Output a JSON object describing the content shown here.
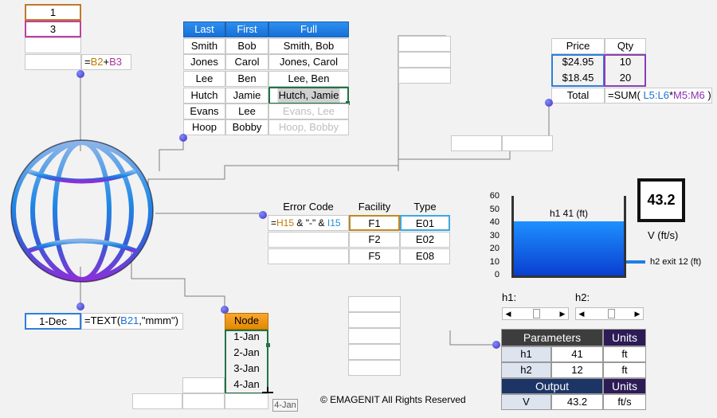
{
  "topleft": {
    "b2": "1",
    "b3": "3",
    "formula_prefix": "=",
    "formula_ref1": "B2",
    "formula_op": "+",
    "formula_ref2": "B3"
  },
  "names": {
    "headers": [
      "Last",
      "First",
      "Full"
    ],
    "rows": [
      [
        "Smith",
        "Bob",
        "Smith, Bob"
      ],
      [
        "Jones",
        "Carol",
        "Jones, Carol"
      ],
      [
        "Lee",
        "Ben",
        "Lee, Ben"
      ],
      [
        "Hutch",
        "Jamie",
        "Hutch, Jamie"
      ],
      [
        "Evans",
        "Lee",
        "Evans, Lee"
      ],
      [
        "Hoop",
        "Bobby",
        "Hoop, Bobby"
      ]
    ]
  },
  "prices": {
    "headers": [
      "Price",
      "Qty"
    ],
    "rows": [
      [
        "$24.95",
        "10"
      ],
      [
        "$18.45",
        "20"
      ]
    ],
    "total_label": "Total",
    "formula": {
      "a": "=SUM(",
      "b": "L5:L6",
      "c": "*",
      "d": "M5:M6",
      "e": ")"
    }
  },
  "errors": {
    "headers": [
      "Error Code",
      "Facility",
      "Type"
    ],
    "formula": {
      "a": "=",
      "b": "H15",
      "c": " & \"-\" & ",
      "d": "I15"
    },
    "rows": [
      [
        "F1",
        "E01"
      ],
      [
        "F2",
        "E02"
      ],
      [
        "F5",
        "E08"
      ]
    ]
  },
  "tank": {
    "y_ticks": [
      "60",
      "50",
      "40",
      "30",
      "20",
      "10",
      "0"
    ],
    "h1_label": "h1 41  (ft)",
    "h2_label": "h2 exit 12 (ft)",
    "display_value": "43.2",
    "v_label": "V (ft/s)",
    "level_fraction": 0.683,
    "h1_slider_label": "h1:",
    "h2_slider_label": "h2:"
  },
  "params": {
    "header": "Parameters",
    "units_header": "Units",
    "rows": [
      [
        "h1",
        "41",
        "ft"
      ],
      [
        "h2",
        "12",
        "ft"
      ]
    ],
    "output_header": "Output",
    "output_units_header": "Units",
    "output_row": [
      "V",
      "43.2",
      "ft/s"
    ]
  },
  "text_fn": {
    "value": "1-Dec",
    "formula_a": "=TEXT(",
    "formula_ref": "B21",
    "formula_b": ",\"mmm\")"
  },
  "nodes": {
    "header": "Node",
    "items": [
      "1-Jan",
      "2-Jan",
      "3-Jan",
      "4-Jan"
    ],
    "drag_tooltip": "4-Jan"
  },
  "footer": {
    "copyright": "© EMAGENIT All Rights Reserved"
  },
  "colors": {
    "blue_hdr": "#1670d6",
    "globe_blue": "#1e88e5",
    "globe_purple": "#7b2fd1",
    "tank_water": "#1e7ee6",
    "ref_orange": "#c07a00",
    "ref_purple": "#8b2fb0",
    "ref_blue": "#1f8fd6"
  }
}
